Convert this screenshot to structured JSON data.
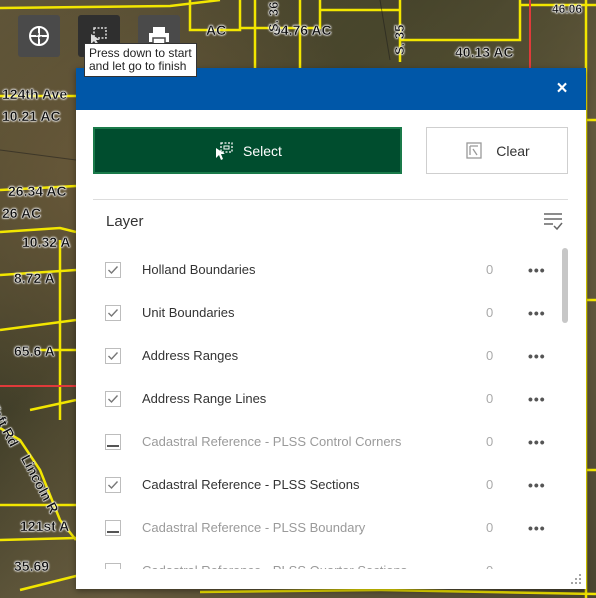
{
  "map": {
    "labels": [
      "94.76 AC",
      "40.13 AC",
      "124th Ave",
      "10.21 AC",
      "26.34 AC",
      "26 AC",
      "10.32 A",
      "8.72 A",
      "65.6 A",
      "121st A",
      "35.69",
      "Taft Rd",
      "Lincoln R",
      "S. 36",
      "S. 35",
      "AC",
      "46.06"
    ]
  },
  "toolbar": {
    "tools": [
      {
        "name": "layers-tool-button",
        "icon": "layers-icon"
      },
      {
        "name": "select-tool-button",
        "icon": "select-rectangle-icon"
      },
      {
        "name": "print-tool-button",
        "icon": "printer-icon"
      }
    ],
    "tooltip": "Press down to start and let go to finish"
  },
  "panel": {
    "close_label": "×",
    "select_label": "Select",
    "clear_label": "Clear",
    "layer_header": "Layer",
    "layers": [
      {
        "label": "Holland Boundaries",
        "count": "0",
        "checked": true,
        "enabled": true
      },
      {
        "label": "Unit Boundaries",
        "count": "0",
        "checked": true,
        "enabled": true
      },
      {
        "label": "Address Ranges",
        "count": "0",
        "checked": true,
        "enabled": true
      },
      {
        "label": "Address Range Lines",
        "count": "0",
        "checked": true,
        "enabled": true
      },
      {
        "label": "Cadastral Reference - PLSS Control Corners",
        "count": "0",
        "checked": false,
        "enabled": false
      },
      {
        "label": "Cadastral Reference - PLSS Sections",
        "count": "0",
        "checked": true,
        "enabled": true
      },
      {
        "label": "Cadastral Reference - PLSS Boundary",
        "count": "0",
        "checked": false,
        "enabled": false
      },
      {
        "label": "Cadastral Reference - PLSS Quarter Sections",
        "count": "0",
        "checked": false,
        "enabled": false
      }
    ],
    "menu_label": "•••"
  },
  "colors": {
    "header": "#0057a8",
    "select_bg": "#004d2e",
    "parcel_line": "#f2e600",
    "road_line": "#e03a3a"
  }
}
